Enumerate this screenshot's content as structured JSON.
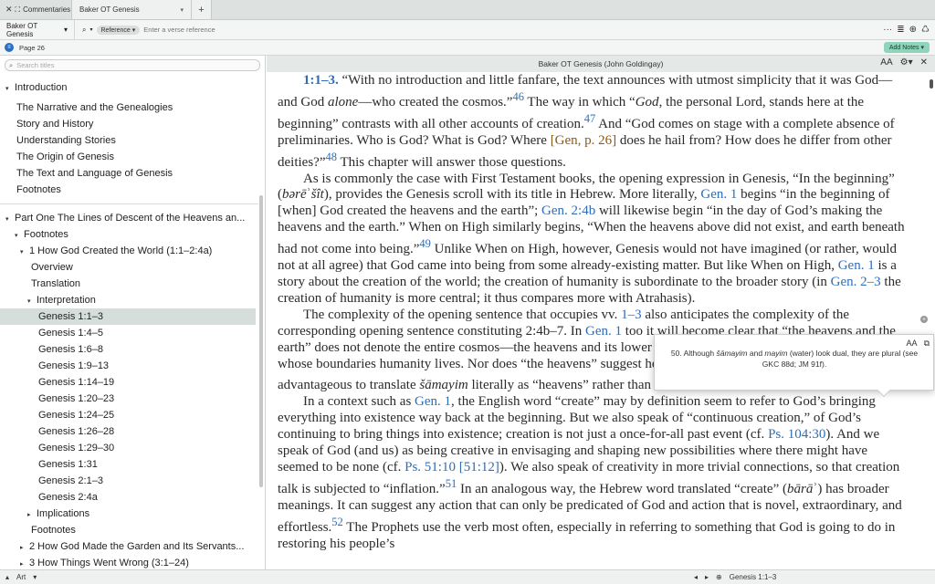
{
  "tabbar": {
    "pane_label": "Commentaries",
    "tab_label": "Baker OT Genesis"
  },
  "toolbar": {
    "resource": "Baker OT Genesis",
    "reference_pill": "Reference",
    "reference_placeholder": "Enter a verse reference"
  },
  "pagebar": {
    "page": "Page 26",
    "add_notes": "Add Notes"
  },
  "sidebar": {
    "search_placeholder": "Search titles",
    "items": [
      {
        "label": "Introduction",
        "level": 0,
        "tri": "▾"
      },
      {
        "label": "The Narrative and the Genealogies",
        "level": 1
      },
      {
        "label": "Story and History",
        "level": 1
      },
      {
        "label": "Understanding Stories",
        "level": 1
      },
      {
        "label": "The Origin of Genesis",
        "level": 1
      },
      {
        "label": "The Text and Language of Genesis",
        "level": 1
      },
      {
        "label": "Footnotes",
        "level": 1
      },
      {
        "label": "Part One The Lines of Descent of the Heavens an...",
        "level": 0,
        "tri": "▾"
      },
      {
        "label": "Footnotes",
        "level": 1,
        "tri": "▾"
      },
      {
        "label": "1 How God Created the World (1:1–2:4a)",
        "level": 2,
        "tri": "▾"
      },
      {
        "label": "Overview",
        "level": 3
      },
      {
        "label": "Translation",
        "level": 3
      },
      {
        "label": "Interpretation",
        "level": 3,
        "tri": "▾"
      },
      {
        "label": "Genesis 1:1–3",
        "level": 4,
        "selected": true
      },
      {
        "label": "Genesis 1:4–5",
        "level": 4
      },
      {
        "label": "Genesis 1:6–8",
        "level": 4
      },
      {
        "label": "Genesis 1:9–13",
        "level": 4
      },
      {
        "label": "Genesis 1:14–19",
        "level": 4
      },
      {
        "label": "Genesis 1:20–23",
        "level": 4
      },
      {
        "label": "Genesis 1:24–25",
        "level": 4
      },
      {
        "label": "Genesis 1:26–28",
        "level": 4
      },
      {
        "label": "Genesis 1:29–30",
        "level": 4
      },
      {
        "label": "Genesis 1:31",
        "level": 4
      },
      {
        "label": "Genesis 2:1–3",
        "level": 4
      },
      {
        "label": "Genesis 2:4a",
        "level": 4
      },
      {
        "label": "Implications",
        "level": 3,
        "tri": "▸"
      },
      {
        "label": "Footnotes",
        "level": 3
      },
      {
        "label": "2 How God Made the Garden and Its Servants...",
        "level": 2,
        "tri": "▸"
      },
      {
        "label": "3 How Things Went Wrong (3:1–24)",
        "level": 2,
        "tri": "▸"
      }
    ]
  },
  "main": {
    "header_title": "Baker OT Genesis (John Goldingay)",
    "font_button": "AA"
  },
  "popup": {
    "text_pre": "50. Although ",
    "w1": "šāmayim",
    "text_mid": " and ",
    "w2": "mayim",
    "text_post": " (water) look dual, they are plural (see GKC 88d; JM 91f).",
    "font_button": "AA"
  },
  "bottombar": {
    "left_label": "Art",
    "right_label": "Genesis 1:1–3"
  }
}
